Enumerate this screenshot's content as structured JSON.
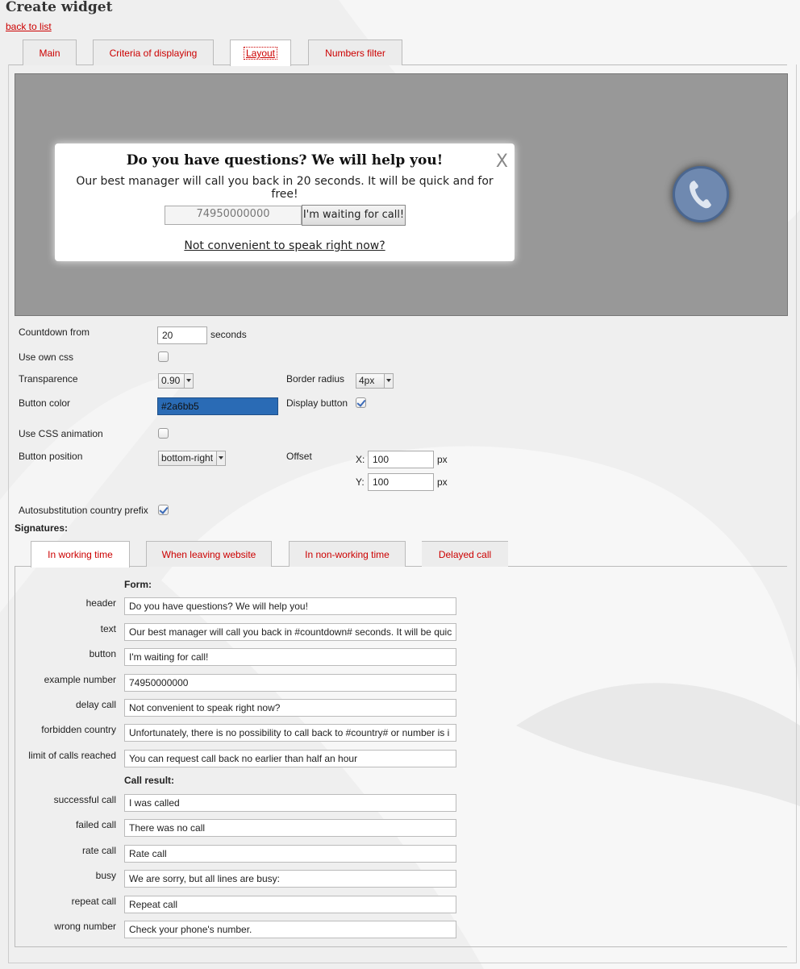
{
  "page_title": "Create widget",
  "back_link": "back to list",
  "top_tabs": [
    {
      "label": "Main"
    },
    {
      "label": "Criteria of displaying"
    },
    {
      "label": "Layout"
    },
    {
      "label": "Numbers filter"
    }
  ],
  "preview": {
    "close": "X",
    "title": "Do you have questions? We will help you!",
    "text": "Our best manager will call you back in 20 seconds. It will be quick and for free!",
    "number_placeholder": "74950000000",
    "button": "I'm waiting for call!",
    "delay_link": "Not convenient to speak right now?",
    "phone_icon": "phone-icon"
  },
  "settings": {
    "countdown_label": "Countdown from",
    "countdown_value": "20",
    "countdown_unit": "seconds",
    "own_css_label": "Use own css",
    "transparence_label": "Transparence",
    "transparence_value": "0.90",
    "border_radius_label": "Border radius",
    "border_radius_value": "4px",
    "button_color_label": "Button color",
    "button_color_value": "#2a6bb5",
    "display_button_label": "Display button",
    "css_animation_label": "Use CSS animation",
    "button_position_label": "Button position",
    "button_position_value": "bottom-right",
    "offset_label": "Offset",
    "offset_x_label": "X:",
    "offset_x_value": "100",
    "offset_y_label": "Y:",
    "offset_y_value": "100",
    "px_unit": "px",
    "autosub_label": "Autosubstitution country prefix"
  },
  "signatures": {
    "title": "Signatures:",
    "tabs": [
      {
        "label": "In working time"
      },
      {
        "label": "When leaving website"
      },
      {
        "label": "In non-working time"
      },
      {
        "label": "Delayed call"
      }
    ],
    "form_title": "Form:",
    "form_rows": [
      {
        "label": "header",
        "value": "Do you have questions? We will help you!"
      },
      {
        "label": "text",
        "value": "Our best manager will call you back in #countdown# seconds. It will be quic"
      },
      {
        "label": "button",
        "value": "I'm waiting for call!"
      },
      {
        "label": "example number",
        "value": "74950000000"
      },
      {
        "label": "delay call",
        "value": "Not convenient to speak right now?"
      },
      {
        "label": "forbidden country",
        "value": "Unfortunately, there is no possibility to call back to #country# or number is i"
      },
      {
        "label": "limit of calls reached",
        "value": "You can request call back no earlier than half an hour"
      }
    ],
    "result_title": "Call result:",
    "result_rows": [
      {
        "label": "successful call",
        "value": "I was called"
      },
      {
        "label": "failed call",
        "value": "There was no call"
      },
      {
        "label": "rate call",
        "value": "Rate call"
      },
      {
        "label": "busy",
        "value": "We are sorry, but all lines are busy:"
      },
      {
        "label": "repeat call",
        "value": "Repeat call"
      },
      {
        "label": "wrong number",
        "value": "Check your phone's number."
      }
    ]
  },
  "colors": {
    "accent_red": "#cc0000",
    "button_blue": "#2a6bb5",
    "preview_bg": "#989898"
  }
}
